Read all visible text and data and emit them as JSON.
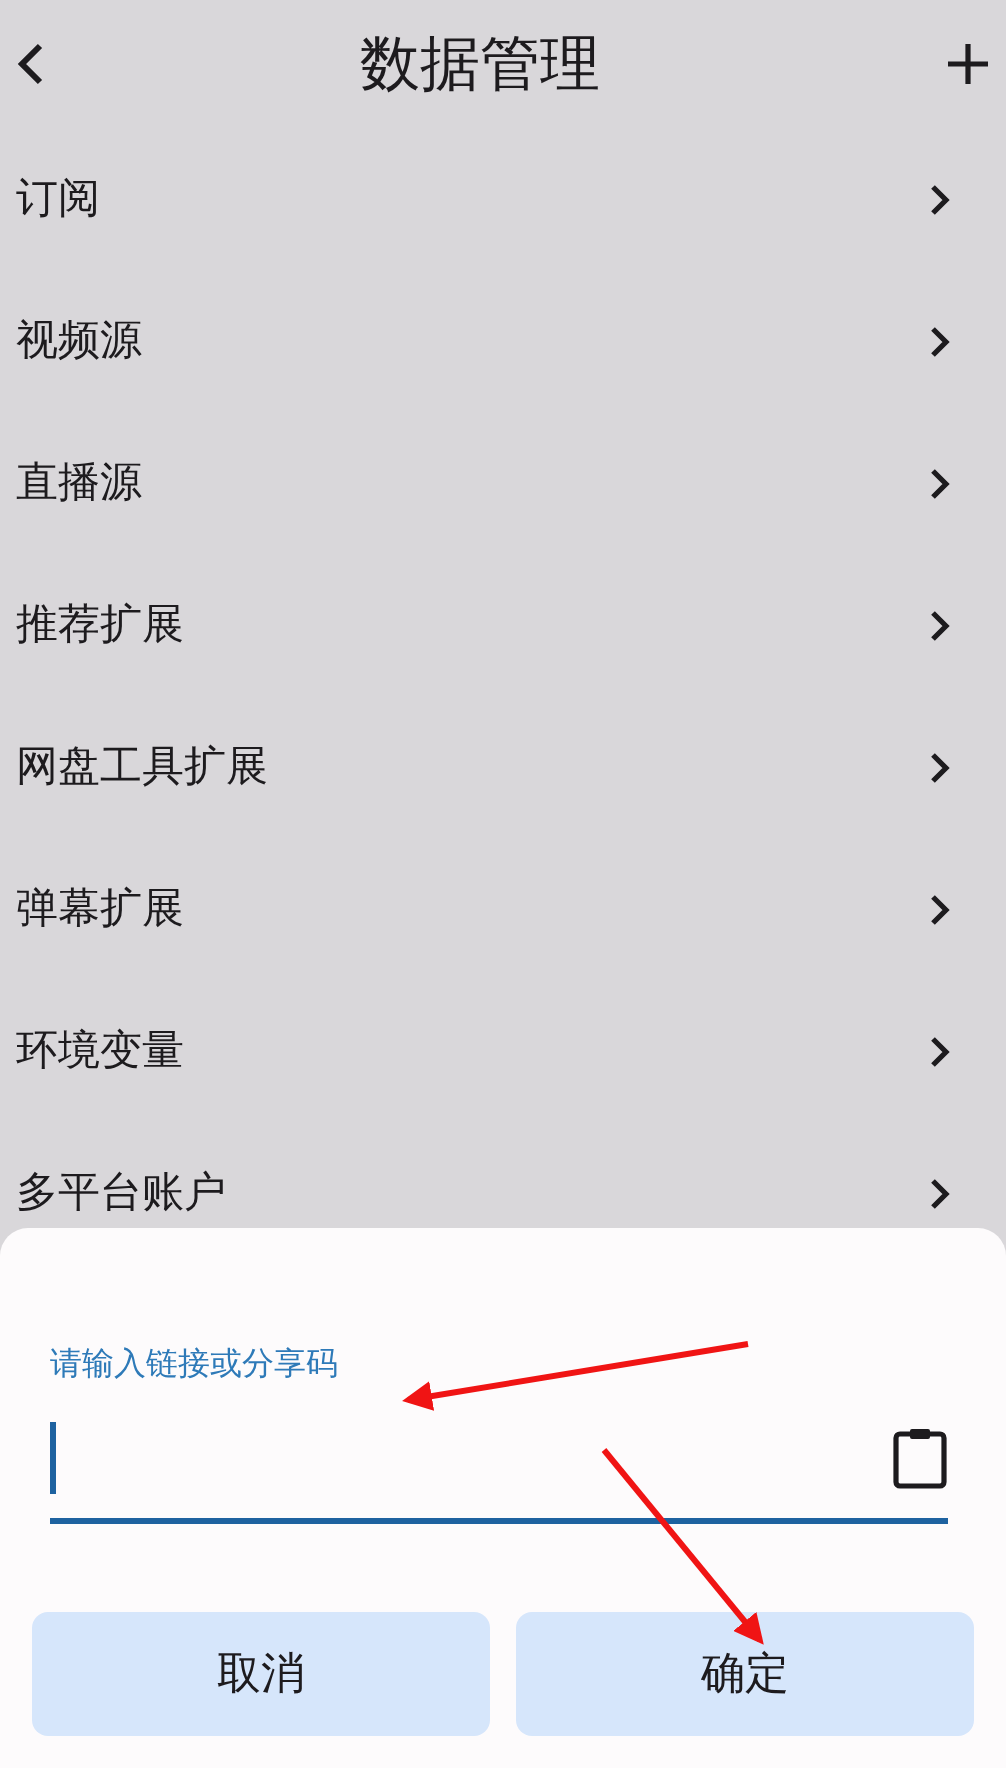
{
  "header": {
    "title": "数据管理"
  },
  "items": [
    {
      "label": "订阅"
    },
    {
      "label": "视频源"
    },
    {
      "label": "直播源"
    },
    {
      "label": "推荐扩展"
    },
    {
      "label": "网盘工具扩展"
    },
    {
      "label": "弹幕扩展"
    },
    {
      "label": "环境变量"
    },
    {
      "label": "多平台账户"
    }
  ],
  "sheet": {
    "field": {
      "label": "请输入链接或分享码",
      "focused": true
    },
    "buttons": [
      {
        "label": "取消"
      },
      {
        "label": "确定"
      }
    ]
  }
}
